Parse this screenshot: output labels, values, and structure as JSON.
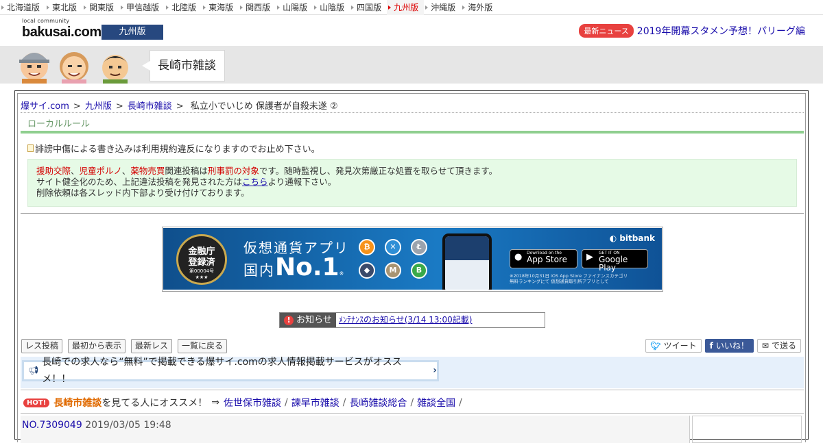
{
  "regions": [
    "北海道版",
    "東北版",
    "関東版",
    "甲信越版",
    "北陸版",
    "東海版",
    "関西版",
    "山陽版",
    "山陰版",
    "四国版",
    "九州版",
    "沖縄版",
    "海外版"
  ],
  "active_region": "九州版",
  "logo": {
    "small": "local community",
    "main": "bakusai.com"
  },
  "edition": "九州版",
  "news": {
    "badge": "最新ニュース",
    "text": "2019年開幕スタメン予想！パリーグ編"
  },
  "board_title": "長崎市雑談",
  "breadcrumb": {
    "home": "爆サイ.com",
    "region": "九州版",
    "board": "長崎市雑談",
    "current": "私立小でいじめ 保護者が自殺未遂 ②",
    "sep": ">"
  },
  "local_rule_label": "ローカルルール",
  "warning": "誹謗中傷による書き込みは利用規約違反になりますのでお止め下さい。",
  "notice_box": {
    "w1": "援助交際",
    "c1": "、",
    "w2": "児童ポルノ",
    "c2": "、",
    "w3": "薬物売買",
    "mid": "関連投稿は",
    "w4": "刑事罰の対象",
    "tail": "です。随時監視し、発見次第厳正な処置を取らせて頂きます。",
    "line2a": "サイト健全化のため、上記違法投稿を発見された方は",
    "line2link": "こちら",
    "line2b": "より通報下さい。",
    "line3": "削除依頼は各スレッド内下部より受け付けております。"
  },
  "ad": {
    "seal1": "金融庁",
    "seal2": "登録済",
    "seal3": "第00004号",
    "seal4": "★★★",
    "title1": "仮想通貨アプリ",
    "title2a": "国内",
    "title2b": "No.1",
    "mark": "※",
    "brand": "bitbank",
    "appstore_small": "Download on the",
    "appstore": "App Store",
    "gplay_small": "GET IT ON",
    "gplay": "Google Play",
    "fine1": "※2018年10月31日 iOS App Store ファイナンスカテゴリ",
    "fine2": "無料ランキングにて 仮想通貨取引所アプリとして"
  },
  "announcement": {
    "label": "お知らせ",
    "link": "ﾒﾝﾃﾅﾝｽのお知らせ(3/14 13:00記載)"
  },
  "buttons": [
    "レス投稿",
    "最初から表示",
    "最新レス",
    "一覧に戻る"
  ],
  "social": {
    "tweet": "ツイート",
    "like": "いいね！",
    "mail": "で送る"
  },
  "job_banner": "長崎での求人なら“無料”で掲載できる爆サイ.comの求人情報掲載サービスがオススメ！！",
  "recommend": {
    "hot": "HOT!",
    "board": "長崎市雑談",
    "text": "を見てる人にオススメ！",
    "arrow": "⇒",
    "links": [
      "佐世保市雑談",
      "諫早市雑談",
      "長崎雑談総合",
      "雑談全国"
    ],
    "slash": "/"
  },
  "post": {
    "no": "NO.7309049",
    "date": "2019/03/05 19:48"
  }
}
